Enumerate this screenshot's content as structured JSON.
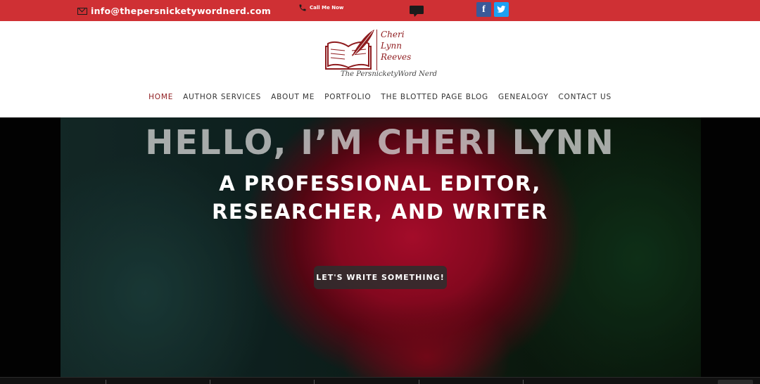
{
  "topbar": {
    "email": "info@thepersnicketywordnerd.com",
    "call_label": "Call Me Now",
    "social": [
      {
        "icon": "facebook-icon",
        "glyph": "f"
      },
      {
        "icon": "twitter-icon",
        "glyph": "t"
      }
    ]
  },
  "logo": {
    "name_lines": [
      "Cheri",
      "Lynn",
      "Reeves"
    ],
    "tagline": "The PersnicketyWord Nerd"
  },
  "nav": {
    "items": [
      "HOME",
      "AUTHOR SERVICES",
      "ABOUT ME",
      "PORTFOLIO",
      "THE BLOTTED PAGE BLOG",
      "GENEALOGY",
      "CONTACT US"
    ],
    "active": "HOME"
  },
  "hero": {
    "title": "HELLO, I’M CHERI LYNN",
    "subtitle_line1": "A PROFESSIONAL EDITOR,",
    "subtitle_line2": "RESEARCHER, AND WRITER",
    "cta_label": "LET'S WRITE SOMETHING!"
  },
  "colors": {
    "topbar": "#cf3034",
    "brand": "#8e1b1e",
    "facebook": "#3b5998",
    "twitter": "#1da1f2"
  }
}
